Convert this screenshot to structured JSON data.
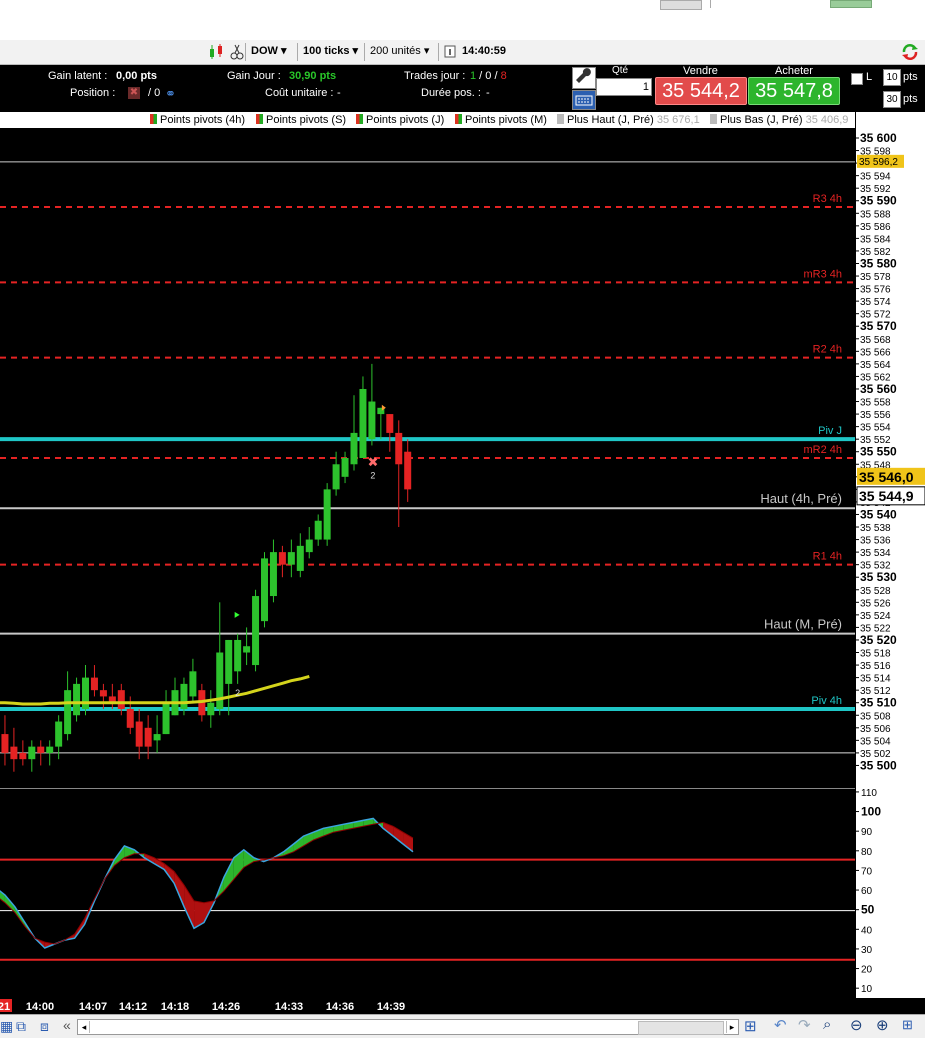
{
  "toolbar": {
    "instrument": "DOW",
    "ticks": "100 ticks",
    "units": "200 unités",
    "time": "14:40:59"
  },
  "info": {
    "gain_latent_label": "Gain latent :",
    "gain_latent_value": "0,00 pts",
    "position_label": "Position :",
    "position_value": "/ 0",
    "gain_jour_label": "Gain Jour :",
    "gain_jour_value": "30,90 pts",
    "cout_label": "Coût unitaire :",
    "cout_value": "-",
    "trades_label": "Trades jour :",
    "trades_a": "1",
    "trades_sep1": " / ",
    "trades_b": "0",
    "trades_sep2": " / ",
    "trades_c": "8",
    "duree_label": "Durée pos. :",
    "duree_value": "-"
  },
  "order": {
    "qty_label": "Qté",
    "qty_value": "1",
    "sell_label": "Vendre",
    "sell_price": "35 544,2",
    "buy_label": "Acheter",
    "buy_price": "35 547,8",
    "l_label": "L",
    "pts_a_value": "10",
    "pts_a_unit": "pts",
    "pts_b_value": "30",
    "pts_b_unit": "pts"
  },
  "legend": [
    {
      "label": "Points pivots (4h)",
      "value": ""
    },
    {
      "label": "Points pivots (S)",
      "value": ""
    },
    {
      "label": "Points pivots (J)",
      "value": ""
    },
    {
      "label": "Points pivots (M)",
      "value": ""
    },
    {
      "label": "Plus Haut (J, Pré)",
      "value": "35 676,1"
    },
    {
      "label": "Plus Bas (J, Pré)",
      "value": "35 406,9"
    }
  ],
  "chart_data": [
    {
      "type": "candlestick",
      "title": "",
      "ylim": [
        35498,
        35600
      ],
      "y_ticks": [
        "35 600",
        "35 598",
        "35 596",
        "35 594",
        "35 592",
        "35 590",
        "35 588",
        "35 586",
        "35 584",
        "35 582",
        "35 580",
        "35 578",
        "35 576",
        "35 574",
        "35 572",
        "35 570",
        "35 568",
        "35 566",
        "35 564",
        "35 562",
        "35 560",
        "35 558",
        "35 556",
        "35 554",
        "35 552",
        "35 550",
        "35 548",
        "35 546",
        "35 544",
        "35 542",
        "35 540",
        "35 538",
        "35 536",
        "35 534",
        "35 532",
        "35 530",
        "35 528",
        "35 526",
        "35 524",
        "35 522",
        "35 520",
        "35 518",
        "35 516",
        "35 514",
        "35 512",
        "35 510",
        "35 508",
        "35 506",
        "35 504",
        "35 502",
        "35 500"
      ],
      "y_bold_ticks": [
        "35 600",
        "35 590",
        "35 580",
        "35 570",
        "35 560",
        "35 550",
        "35 540",
        "35 530",
        "35 520",
        "35 510",
        "35 500"
      ],
      "levels": [
        {
          "name": "R3 4h",
          "value": 35589,
          "color": "#e52323",
          "style": "dashed"
        },
        {
          "name": "mR3 4h",
          "value": 35577,
          "color": "#e52323",
          "style": "dashed"
        },
        {
          "name": "R2 4h",
          "value": 35565,
          "color": "#e52323",
          "style": "dashed"
        },
        {
          "name": "Piv J",
          "value": 35552,
          "color": "#1fc6c6",
          "style": "solid"
        },
        {
          "name": "mR2 4h",
          "value": 35549,
          "color": "#e52323",
          "style": "dashed"
        },
        {
          "name": "Haut (4h, Pré)",
          "value": 35541,
          "color": "#c8c8c8",
          "style": "solid"
        },
        {
          "name": "R1 4h",
          "value": 35532,
          "color": "#e52323",
          "style": "dashed"
        },
        {
          "name": "Haut (M, Pré)",
          "value": 35521,
          "color": "#c8c8c8",
          "style": "solid"
        },
        {
          "name": "Piv 4h",
          "value": 35509,
          "color": "#1fc6c6",
          "style": "solid"
        }
      ],
      "markers": {
        "hline_596": "35 596,2",
        "last_ask": "35 546,0",
        "last_bid": "35 544,9"
      },
      "candles": [
        {
          "o": 35506,
          "h": 35508,
          "l": 35500,
          "c": 35503
        },
        {
          "o": 35505,
          "h": 35508,
          "l": 35500,
          "c": 35502
        },
        {
          "o": 35503,
          "h": 35506,
          "l": 35499,
          "c": 35501
        },
        {
          "o": 35502,
          "h": 35504,
          "l": 35500,
          "c": 35501
        },
        {
          "o": 35501,
          "h": 35504,
          "l": 35499,
          "c": 35503
        },
        {
          "o": 35503,
          "h": 35504,
          "l": 35500,
          "c": 35502
        },
        {
          "o": 35502,
          "h": 35504,
          "l": 35500,
          "c": 35503
        },
        {
          "o": 35503,
          "h": 35508,
          "l": 35501,
          "c": 35507
        },
        {
          "o": 35505,
          "h": 35515,
          "l": 35504,
          "c": 35512
        },
        {
          "o": 35508,
          "h": 35514,
          "l": 35507,
          "c": 35513
        },
        {
          "o": 35509,
          "h": 35516,
          "l": 35508,
          "c": 35514
        },
        {
          "o": 35514,
          "h": 35516,
          "l": 35511,
          "c": 35512
        },
        {
          "o": 35512,
          "h": 35513,
          "l": 35509,
          "c": 35511
        },
        {
          "o": 35511,
          "h": 35513,
          "l": 35509,
          "c": 35510
        },
        {
          "o": 35512,
          "h": 35513,
          "l": 35508,
          "c": 35509
        },
        {
          "o": 35509,
          "h": 35511,
          "l": 35505,
          "c": 35506
        },
        {
          "o": 35507,
          "h": 35509,
          "l": 35501,
          "c": 35503
        },
        {
          "o": 35506,
          "h": 35508,
          "l": 35501,
          "c": 35503
        },
        {
          "o": 35504,
          "h": 35508,
          "l": 35502,
          "c": 35505
        },
        {
          "o": 35505,
          "h": 35512,
          "l": 35505,
          "c": 35510
        },
        {
          "o": 35508,
          "h": 35514,
          "l": 35508,
          "c": 35512
        },
        {
          "o": 35509,
          "h": 35514,
          "l": 35508,
          "c": 35513
        },
        {
          "o": 35511,
          "h": 35517,
          "l": 35510,
          "c": 35515
        },
        {
          "o": 35512,
          "h": 35513,
          "l": 35507,
          "c": 35508
        },
        {
          "o": 35508,
          "h": 35512,
          "l": 35506,
          "c": 35510
        },
        {
          "o": 35509,
          "h": 35526,
          "l": 35508,
          "c": 35518
        },
        {
          "o": 35513,
          "h": 35520,
          "l": 35508,
          "c": 35520
        },
        {
          "o": 35515,
          "h": 35521,
          "l": 35513,
          "c": 35520
        },
        {
          "o": 35518,
          "h": 35522,
          "l": 35516,
          "c": 35519
        },
        {
          "o": 35516,
          "h": 35528,
          "l": 35515,
          "c": 35527
        },
        {
          "o": 35523,
          "h": 35534,
          "l": 35522,
          "c": 35533
        },
        {
          "o": 35527,
          "h": 35536,
          "l": 35526,
          "c": 35534
        },
        {
          "o": 35534,
          "h": 35535,
          "l": 35530,
          "c": 35532
        },
        {
          "o": 35532,
          "h": 35536,
          "l": 35530,
          "c": 35534
        },
        {
          "o": 35531,
          "h": 35537,
          "l": 35530,
          "c": 35535
        },
        {
          "o": 35534,
          "h": 35538,
          "l": 35533,
          "c": 35536
        },
        {
          "o": 35536,
          "h": 35540,
          "l": 35535,
          "c": 35539
        },
        {
          "o": 35536,
          "h": 35545,
          "l": 35535,
          "c": 35544
        },
        {
          "o": 35544,
          "h": 35550,
          "l": 35543,
          "c": 35548
        },
        {
          "o": 35546,
          "h": 35550,
          "l": 35545,
          "c": 35549
        },
        {
          "o": 35548,
          "h": 35559,
          "l": 35547,
          "c": 35553
        },
        {
          "o": 35549,
          "h": 35562,
          "l": 35549,
          "c": 35560
        },
        {
          "o": 35552,
          "h": 35564,
          "l": 35551,
          "c": 35558
        },
        {
          "o": 35556,
          "h": 35557,
          "l": 35552,
          "c": 35557
        },
        {
          "o": 35556,
          "h": 35556,
          "l": 35550,
          "c": 35553
        },
        {
          "o": 35553,
          "h": 35555,
          "l": 35538,
          "c": 35548
        },
        {
          "o": 35550,
          "h": 35552,
          "l": 35542,
          "c": 35544
        }
      ],
      "moving_average": [
        35510,
        35510,
        35509.9,
        35509.8,
        35509.8,
        35509.8,
        35509.9,
        35509.9,
        35510,
        35510,
        35510,
        35510,
        35510,
        35510,
        35510,
        35510,
        35510,
        35510,
        35510,
        35510,
        35510,
        35510,
        35510.1,
        35510.2,
        35510.4,
        35510.6,
        35510.9,
        35511.2,
        35511.5,
        35511.9,
        35512.3,
        35512.7,
        35513.1,
        35513.5,
        35513.8,
        35514.2
      ],
      "annotations": [
        {
          "text": "2",
          "kind": "trade-count"
        },
        {
          "text": "2",
          "kind": "trade-count"
        }
      ]
    },
    {
      "type": "area",
      "title": "",
      "ylim": [
        5,
        112
      ],
      "y_ticks": [
        "110",
        "100",
        "90",
        "80",
        "70",
        "60",
        "50",
        "40",
        "30",
        "20",
        "10"
      ],
      "y_bold_ticks": [
        "100",
        "50"
      ],
      "hlines": [
        {
          "value": 76,
          "color": "#e52323"
        },
        {
          "value": 50,
          "color": "#ffffff"
        },
        {
          "value": 25,
          "color": "#e52323"
        }
      ],
      "fast": [
        62,
        58,
        52,
        44,
        36,
        31,
        33,
        35,
        36,
        43,
        55,
        66,
        76,
        83,
        81,
        77,
        74,
        71,
        64,
        52,
        41,
        44,
        54,
        67,
        77,
        81,
        77,
        75,
        77,
        80,
        84,
        88,
        90,
        92,
        93,
        94,
        95,
        96,
        97,
        92,
        88,
        84,
        80
      ],
      "slow": [
        58,
        54,
        49,
        42,
        36,
        34,
        33,
        35,
        38,
        46,
        56,
        66,
        73,
        77,
        79,
        79,
        77,
        74,
        70,
        63,
        55,
        54,
        55,
        60,
        66,
        72,
        75,
        76,
        77,
        78,
        80,
        83,
        86,
        88,
        90,
        91,
        92,
        93,
        94,
        95,
        93,
        90,
        87
      ]
    }
  ],
  "time_axis": {
    "labels": [
      "21",
      "14:00",
      "14:07",
      "14:12",
      "14:18",
      "14:26",
      "14:33",
      "14:36",
      "14:39"
    ]
  },
  "colors": {
    "bull": "#2dc22d",
    "bear": "#e52323",
    "ma": "#d4d41c",
    "pivot": "#1fc6c6",
    "sell_bg": "#e24b4b",
    "buy_bg": "#2db52d",
    "ask_marker": "#f0c419"
  },
  "icons": [
    "candlestick-icon",
    "scissors-icon",
    "dropdown-arrow-icon",
    "info-icon",
    "refresh-icon",
    "wrench-icon",
    "keyboard-icon",
    "checkbox-icon",
    "link-icon",
    "arrows-icon",
    "left-arrow-icon",
    "undo-icon",
    "redo-icon",
    "zoom-in-icon",
    "zoom-out-icon",
    "magnifier-icon",
    "grid-icon"
  ]
}
